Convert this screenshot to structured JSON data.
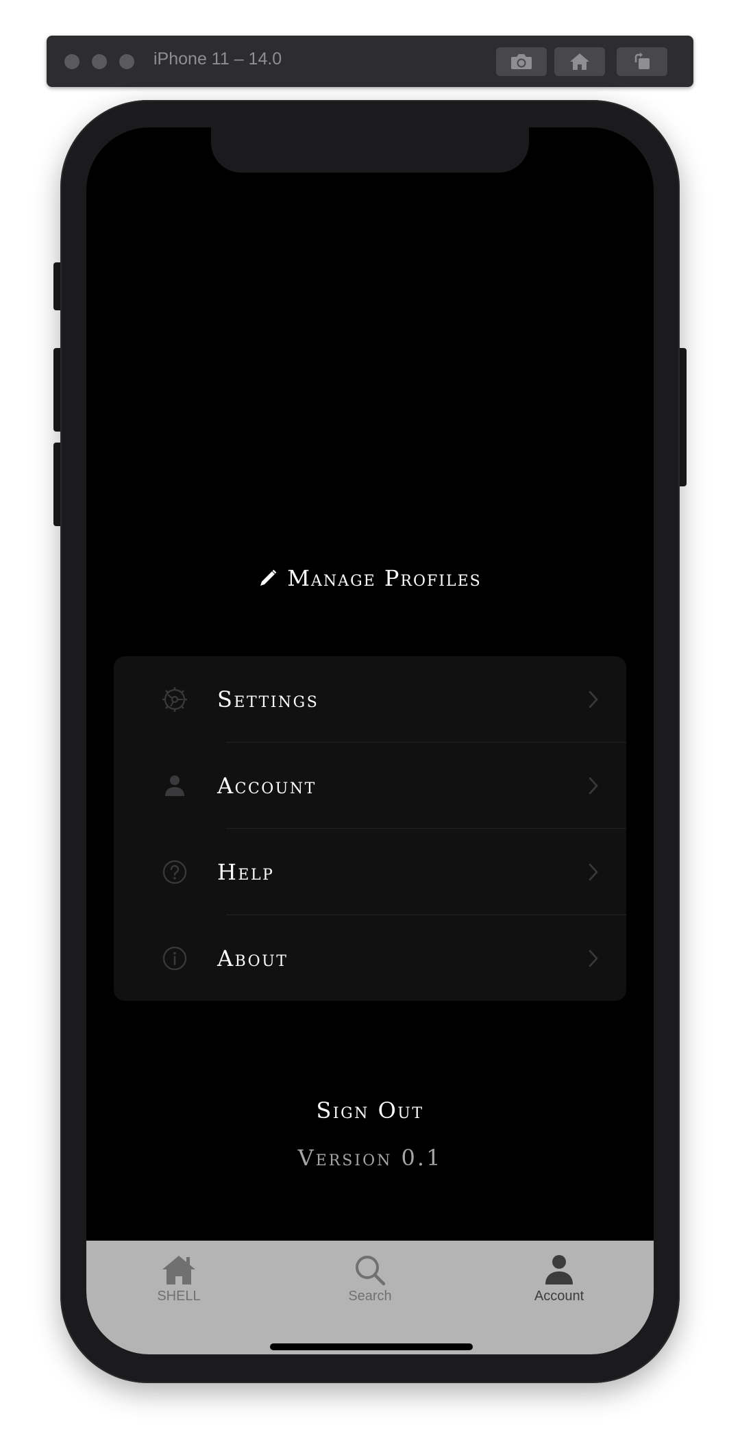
{
  "simulator": {
    "title": "iPhone 11 – 14.0",
    "buttons": [
      "screenshot-icon",
      "home-icon",
      "rotate-icon"
    ]
  },
  "screen": {
    "manage_profiles": "Manage Profiles",
    "menu": [
      {
        "label": "Settings",
        "icon": "gear-icon"
      },
      {
        "label": "Account",
        "icon": "person-icon"
      },
      {
        "label": "Help",
        "icon": "question-icon"
      },
      {
        "label": "About",
        "icon": "info-icon"
      }
    ],
    "sign_out": "Sign Out",
    "version": "Version 0.1"
  },
  "tab_bar": {
    "tabs": [
      {
        "label": "SHELL",
        "icon": "house-icon",
        "selected": false
      },
      {
        "label": "Search",
        "icon": "search-icon",
        "selected": false
      },
      {
        "label": "Account",
        "icon": "person-icon",
        "selected": true
      }
    ]
  },
  "colors": {
    "screen_background": "#000000",
    "card_background": "#111112",
    "tab_bar_background": "#b4b4b4",
    "tab_selected": "#3c3c3c",
    "tab_unselected": "#707070",
    "version_text": "#a5a5a8"
  }
}
